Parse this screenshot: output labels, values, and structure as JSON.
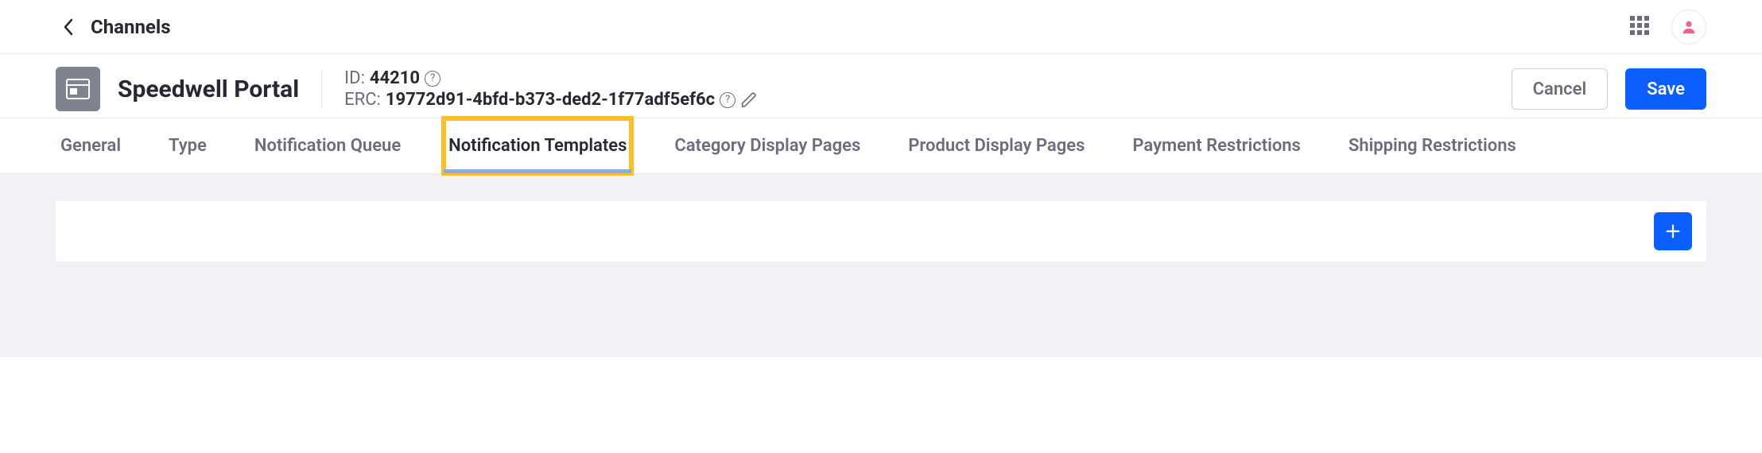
{
  "breadcrumb": {
    "title": "Channels"
  },
  "header": {
    "site_name": "Speedwell Portal",
    "id_label": "ID:",
    "id_value": "44210",
    "erc_label": "ERC:",
    "erc_value": "19772d91-4bfd-b373-ded2-1f77adf5ef6c",
    "cancel_label": "Cancel",
    "save_label": "Save"
  },
  "tabs": [
    {
      "label": "General",
      "active": false,
      "highlighted": false
    },
    {
      "label": "Type",
      "active": false,
      "highlighted": false
    },
    {
      "label": "Notification Queue",
      "active": false,
      "highlighted": false
    },
    {
      "label": "Notification Templates",
      "active": true,
      "highlighted": true
    },
    {
      "label": "Category Display Pages",
      "active": false,
      "highlighted": false
    },
    {
      "label": "Product Display Pages",
      "active": false,
      "highlighted": false
    },
    {
      "label": "Payment Restrictions",
      "active": false,
      "highlighted": false
    },
    {
      "label": "Shipping Restrictions",
      "active": false,
      "highlighted": false
    }
  ],
  "icons": {
    "back": "chevron-left-icon",
    "apps": "apps-grid-icon",
    "avatar": "user-avatar-icon",
    "site": "site-page-icon",
    "help": "help-icon",
    "edit": "pencil-icon",
    "add": "plus-icon"
  }
}
